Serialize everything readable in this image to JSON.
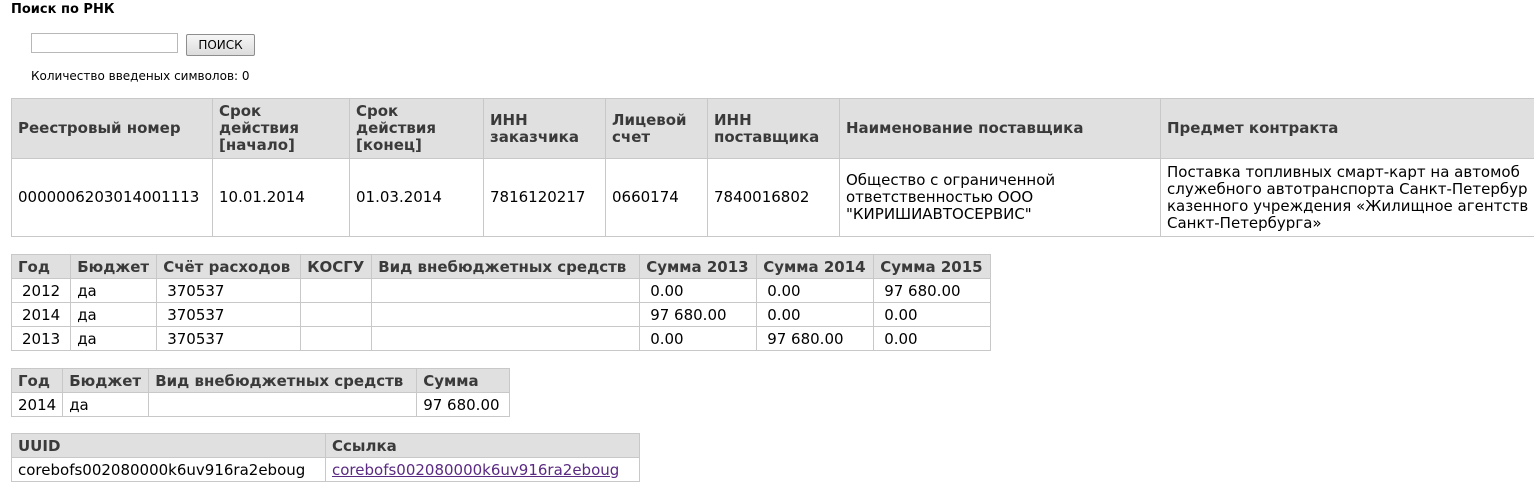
{
  "page": {
    "title": "Поиск по РНК"
  },
  "search": {
    "value": "",
    "button_label": "ПОИСК",
    "count_text": "Количество введеных символов: 0"
  },
  "contract_table": {
    "headers": [
      "Реестровый номер",
      "Срок действия [начало]",
      "Срок действия [конец]",
      "ИНН заказчика",
      "Лицевой счет",
      "ИНН поставщика",
      "Наименование поставщика",
      "Предмет контракта"
    ],
    "row": {
      "reg_number": "0000006203014001113",
      "start": "10.01.2014",
      "end": "01.03.2014",
      "customer_inn": "7816120217",
      "account": "0660174",
      "supplier_inn": "7840016802",
      "supplier_name": [
        "Общество с ограниченной",
        "ответственностью ООО",
        "\"КИРИШИАВТОСЕРВИС\""
      ],
      "subject": [
        "Поставка топливных смарт-карт на автомоб",
        "служебного автотранспорта Санкт-Петербур",
        "казенного учреждения «Жилищное агентств",
        "Санкт-Петербурга»"
      ]
    }
  },
  "budget_table": {
    "headers": [
      "Год",
      "Бюджет",
      "Счёт расходов",
      "КОСГУ",
      "Вид внебюджетных средств",
      "Сумма 2013",
      "Сумма 2014",
      "Сумма 2015"
    ],
    "rows": [
      [
        "2012",
        "да",
        "370537",
        "",
        "",
        "0.00",
        "0.00",
        "97 680.00"
      ],
      [
        "2014",
        "да",
        "370537",
        "",
        "",
        "97 680.00",
        "0.00",
        "0.00"
      ],
      [
        "2013",
        "да",
        "370537",
        "",
        "",
        "0.00",
        "97 680.00",
        "0.00"
      ]
    ]
  },
  "sum_table": {
    "headers": [
      "Год",
      "Бюджет",
      "Вид внебюджетных средств",
      "Сумма"
    ],
    "rows": [
      [
        "2014",
        "да",
        "",
        "97 680.00"
      ]
    ]
  },
  "uuid_table": {
    "headers": [
      "UUID",
      "Ссылка"
    ],
    "uuid": "corebofs002080000k6uv916ra2eboug",
    "link_text": "corebofs002080000k6uv916ra2eboug"
  }
}
